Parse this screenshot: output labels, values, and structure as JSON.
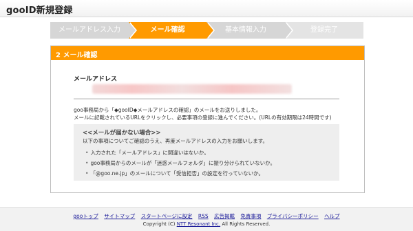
{
  "page": {
    "title": "gooID新規登録"
  },
  "steps": [
    {
      "label": "メールアドレス入力",
      "state": "inactive"
    },
    {
      "label": "メール確認",
      "state": "active"
    },
    {
      "label": "基本情報入力",
      "state": "inactive"
    },
    {
      "label": "登録完了",
      "state": "inactive"
    }
  ],
  "panel": {
    "header": "2 メール確認",
    "email_label": "メールアドレス",
    "message_line1": "goo事務局から「◆gooID◆メールアドレスの確認」のメールをお送りしました。",
    "message_line2": "メールに記載されているURLをクリックし、必要事項の登録に進んでください。(URLの有効期限は24時間です)"
  },
  "notice": {
    "title": "<<メールが届かない場合>>",
    "intro": "以下の事項についてご確認のうえ、再度メールアドレスの入力をお願いします。",
    "items": [
      "入力された「メールアドレス」に間違いはないか。",
      "goo事務局からのメールが「迷惑メールフォルダ」に振り分けられていないか。",
      "「@goo.ne.jp」のメールについて「受信拒否」の設定を行っていないか。"
    ]
  },
  "footer": {
    "links": [
      "gooトップ",
      "サイトマップ",
      "スタートページに設定",
      "RSS",
      "広告掲載",
      "免責事項",
      "プライバシーポリシー",
      "ヘルプ"
    ],
    "copyright_prefix": "Copyright (C)",
    "copyright_company": "NTT Resonant Inc.",
    "copyright_suffix": "All Rights Reserved."
  },
  "colors": {
    "accent": "#ff9a00",
    "step_inactive": "#d6d6d6",
    "link": "#1a1a99"
  }
}
